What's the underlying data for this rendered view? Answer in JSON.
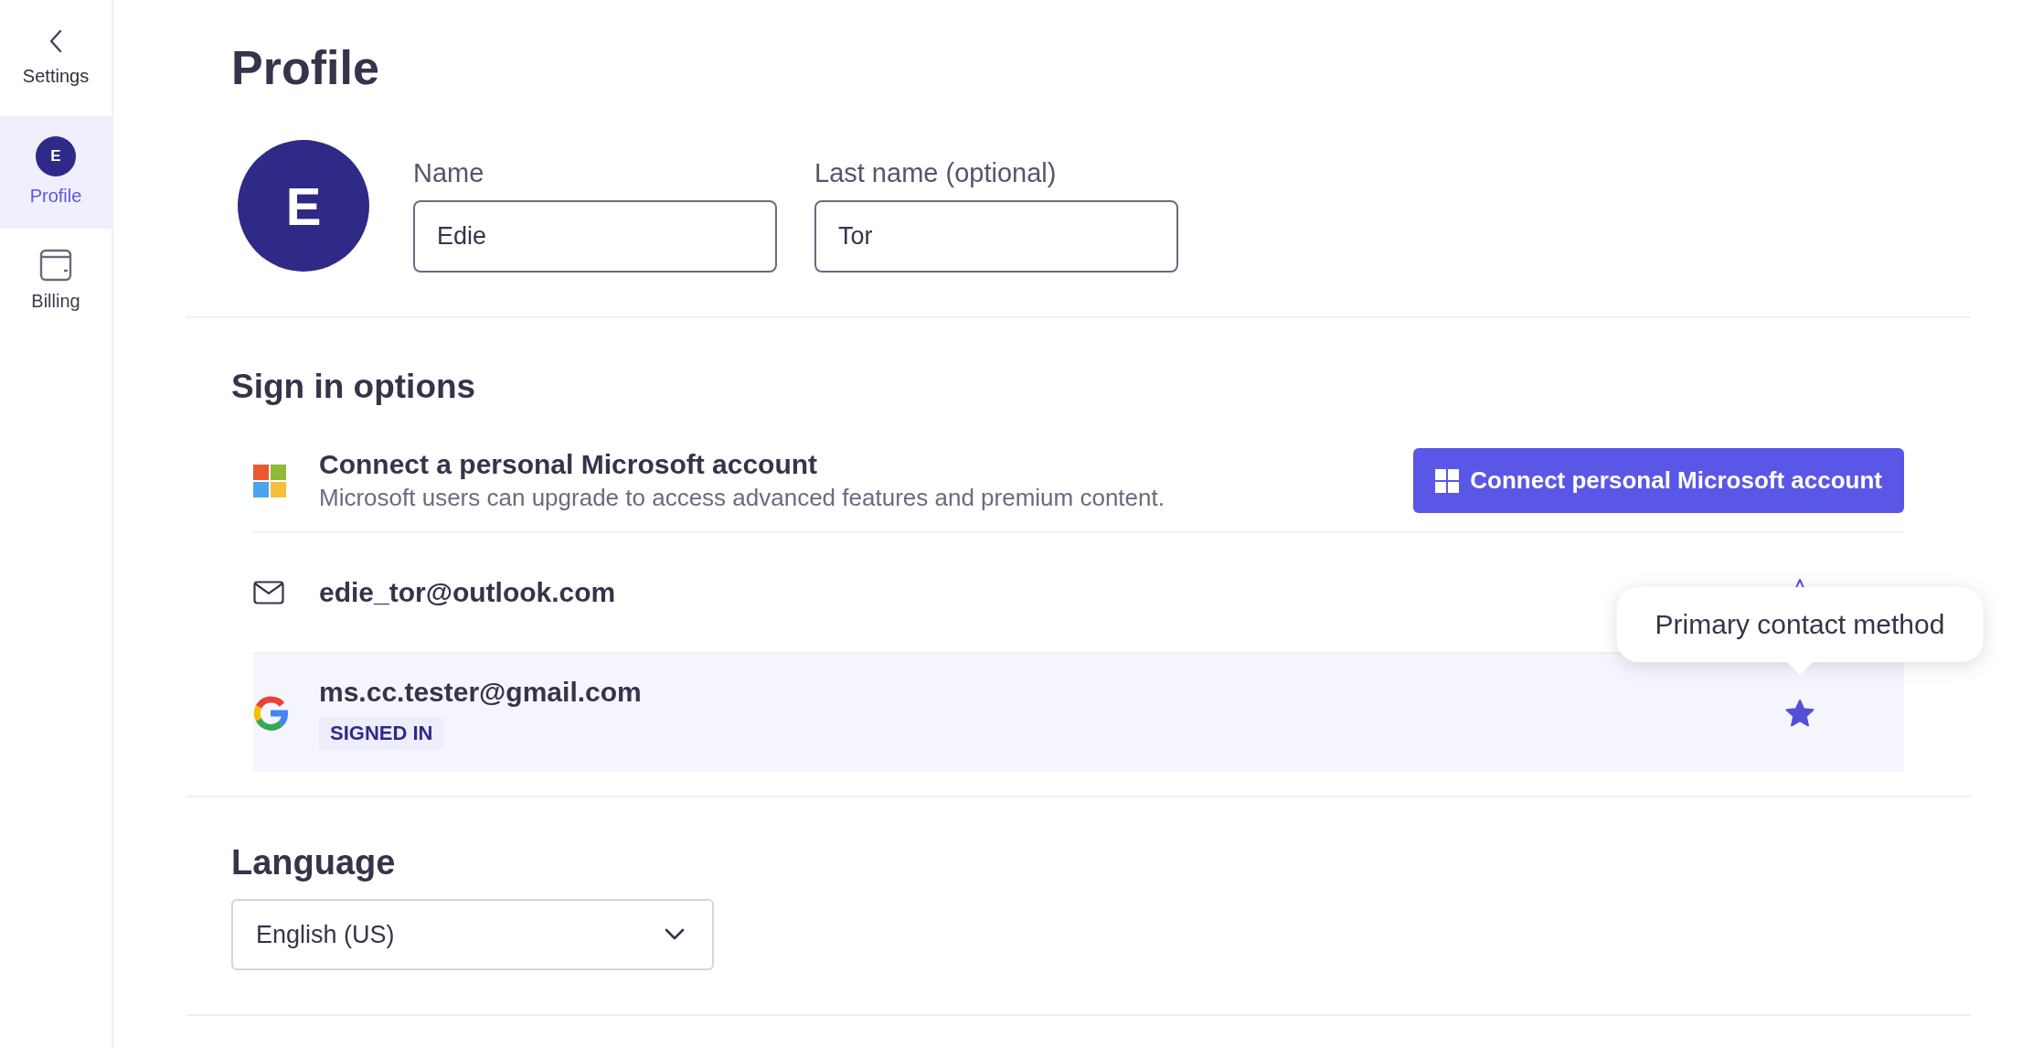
{
  "sidebar": {
    "back": {
      "label": "Settings"
    },
    "items": [
      {
        "kind": "avatar",
        "initial": "E",
        "label": "Profile",
        "selected": true
      },
      {
        "kind": "wallet",
        "label": "Billing",
        "selected": false
      }
    ]
  },
  "profile": {
    "title": "Profile",
    "avatar_initial": "E",
    "fields": [
      {
        "label": "Name",
        "value": "Edie"
      },
      {
        "label": "Last name (optional)",
        "value": "Tor"
      }
    ]
  },
  "sign_in": {
    "title": "Sign in options",
    "rows": [
      {
        "kind": "microsoft",
        "title": "Connect a personal Microsoft account",
        "description": "Microsoft users can upgrade to access advanced features and premium content.",
        "button": "Connect personal Microsoft account"
      },
      {
        "kind": "email",
        "address": "edie_tor@outlook.com",
        "primary": false
      },
      {
        "kind": "google",
        "address": "ms.cc.tester@gmail.com",
        "badge": "SIGNED IN",
        "primary": true,
        "tooltip": "Primary contact method"
      }
    ]
  },
  "language": {
    "title": "Language",
    "value": "English (US)"
  }
}
